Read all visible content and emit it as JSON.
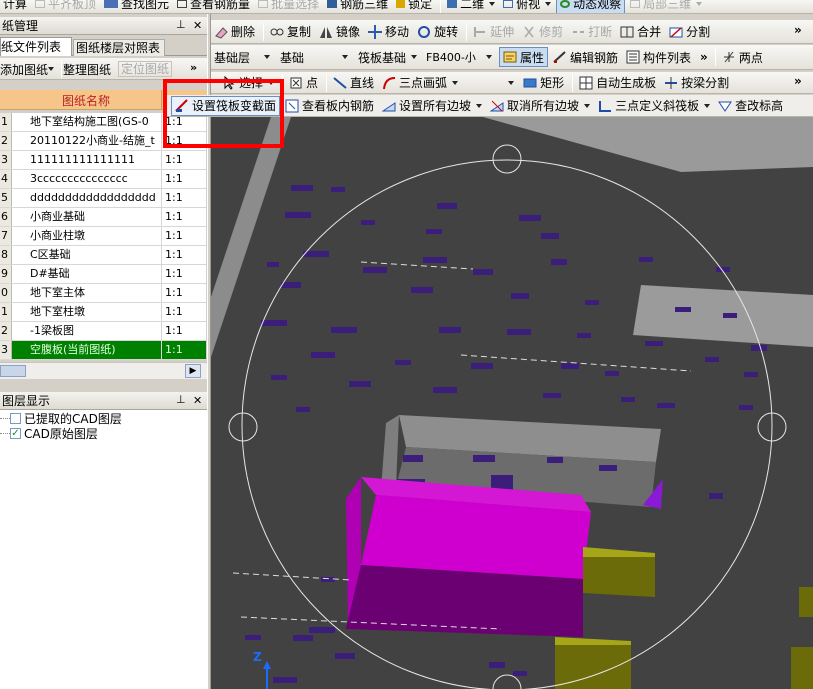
{
  "toolbar_top": {
    "items": [
      {
        "label": "计算",
        "disabled": false
      },
      {
        "label": "平齐板顶",
        "disabled": true
      },
      {
        "label": "查找图元",
        "disabled": false
      },
      {
        "label": "查看钢筋量",
        "disabled": false
      },
      {
        "label": "批量选择",
        "disabled": true
      },
      {
        "label": "钢筋三维",
        "disabled": false
      },
      {
        "label": "锁定",
        "disabled": false
      },
      {
        "label": "二维",
        "disabled": false
      },
      {
        "label": "俯视",
        "disabled": false
      },
      {
        "label": "动态观察",
        "disabled": false
      },
      {
        "label": "局部三维",
        "disabled": true
      }
    ]
  },
  "toolbar_edit": {
    "items": [
      {
        "label": "删除",
        "disabled": false
      },
      {
        "label": "复制",
        "disabled": false
      },
      {
        "label": "镜像",
        "disabled": false
      },
      {
        "label": "移动",
        "disabled": false
      },
      {
        "label": "旋转",
        "disabled": false
      },
      {
        "label": "延伸",
        "disabled": true
      },
      {
        "label": "修剪",
        "disabled": true
      },
      {
        "label": "打断",
        "disabled": true
      },
      {
        "label": "合并",
        "disabled": false
      },
      {
        "label": "分割",
        "disabled": false
      }
    ]
  },
  "toolbar_layer": {
    "layer": "基础层",
    "category": "基础",
    "type": "筏板基础",
    "component": "FB400-小",
    "attr_label": "属性",
    "edit_rebar_label": "编辑钢筋",
    "component_list_label": "构件列表",
    "two_points_label": "两点"
  },
  "toolbar_draw": {
    "select_label": "选择",
    "point_label": "点",
    "line_label": "直线",
    "arc_label": "三点画弧",
    "rect_label": "矩形",
    "autogen_label": "自动生成板",
    "split_by_beam_label": "按梁分割"
  },
  "toolbar_slab": {
    "set_section_label": "设置筏板变截面",
    "view_rebar_label": "查看板内钢筋",
    "set_all_slopes_label": "设置所有边坡",
    "cancel_all_slopes_label": "取消所有边坡",
    "three_point_label": "三点定义斜筏板",
    "check_elev_label": "查改标高"
  },
  "drawing_panel": {
    "title": "纸管理",
    "tab_files": "纸文件列表",
    "tab_floors": "图纸楼层对照表",
    "btn_add": "添加图纸",
    "btn_organize": "整理图纸",
    "btn_locate": "定位图纸",
    "col_name": "图纸名称",
    "rows": [
      {
        "num": "1",
        "name": "地下室结构施工图(GS-0",
        "ratio": "1:1"
      },
      {
        "num": "2",
        "name": "20110122小商业-结施_t",
        "ratio": "1:1"
      },
      {
        "num": "3",
        "name": "111111111111111",
        "ratio": "1:1"
      },
      {
        "num": "4",
        "name": "3ccccccccccccccc",
        "ratio": "1:1"
      },
      {
        "num": "5",
        "name": "dddddddddddddddddd",
        "ratio": "1:1"
      },
      {
        "num": "6",
        "name": "小商业基础",
        "ratio": "1:1"
      },
      {
        "num": "7",
        "name": "小商业柱墩",
        "ratio": "1:1"
      },
      {
        "num": "8",
        "name": "C区基础",
        "ratio": "1:1"
      },
      {
        "num": "9",
        "name": "D#基础",
        "ratio": "1:1"
      },
      {
        "num": "0",
        "name": "地下室主体",
        "ratio": "1:1"
      },
      {
        "num": "1",
        "name": "地下室柱墩",
        "ratio": "1:1"
      },
      {
        "num": "2",
        "name": "-1梁板图",
        "ratio": "1:1"
      },
      {
        "num": "3",
        "name": "空腹板(当前图纸)",
        "ratio": "1:1"
      }
    ]
  },
  "layer_panel": {
    "title": "图层显示",
    "items": [
      {
        "label": "已提取的CAD图层",
        "checked": false
      },
      {
        "label": "CAD原始图层",
        "checked": true
      }
    ]
  },
  "viewport": {
    "axis_label": "Z"
  },
  "colors": {
    "highlight_box": "#ff0000",
    "current_row": "#008000",
    "header_orange": "#f6c58a",
    "viewport_bg": "#424242",
    "magenta": "#cc00cc",
    "purple_block": "#3a1e7a"
  }
}
